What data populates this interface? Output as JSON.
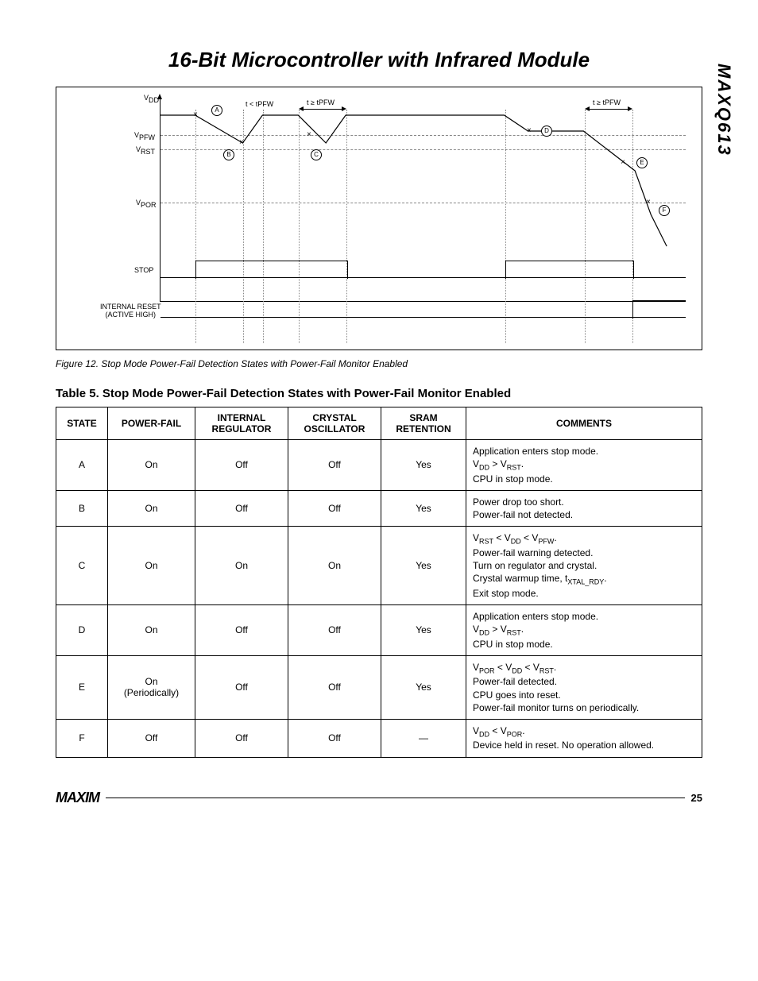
{
  "title": "16-Bit Microcontroller with Infrared Module",
  "part_number": "MAXQ613",
  "figure": {
    "caption": "Figure 12. Stop Mode Power-Fail Detection States with Power-Fail Monitor Enabled",
    "y_axis_label": "VDD",
    "levels": {
      "vpfw": "VPFW",
      "vrst": "VRST",
      "vpor": "VPOR"
    },
    "time_labels": {
      "t_lt": "t < tPFW",
      "t_ge1": "t ≥ tPFW",
      "t_ge2": "t ≥ tPFW"
    },
    "signals": {
      "stop": "STOP",
      "reset": "INTERNAL RESET\n(ACTIVE HIGH)"
    },
    "markers": [
      "A",
      "B",
      "C",
      "D",
      "E",
      "F"
    ]
  },
  "table": {
    "title": "Table 5. Stop Mode Power-Fail Detection States with Power-Fail Monitor Enabled",
    "headers": [
      "STATE",
      "POWER-FAIL",
      "INTERNAL REGULATOR",
      "CRYSTAL OSCILLATOR",
      "SRAM RETENTION",
      "COMMENTS"
    ],
    "rows": [
      {
        "state": "A",
        "pf": "On",
        "reg": "Off",
        "osc": "Off",
        "sram": "Yes",
        "comments": "Application enters stop mode.\nVDD > VRST.\nCPU in stop mode."
      },
      {
        "state": "B",
        "pf": "On",
        "reg": "Off",
        "osc": "Off",
        "sram": "Yes",
        "comments": "Power drop too short.\nPower-fail not detected."
      },
      {
        "state": "C",
        "pf": "On",
        "reg": "On",
        "osc": "On",
        "sram": "Yes",
        "comments": "VRST < VDD < VPFW.\nPower-fail warning detected.\nTurn on regulator and crystal.\nCrystal warmup time, tXTAL_RDY.\nExit stop mode."
      },
      {
        "state": "D",
        "pf": "On",
        "reg": "Off",
        "osc": "Off",
        "sram": "Yes",
        "comments": "Application enters stop mode.\nVDD > VRST.\nCPU in stop mode."
      },
      {
        "state": "E",
        "pf": "On\n(Periodically)",
        "reg": "Off",
        "osc": "Off",
        "sram": "Yes",
        "comments": "VPOR < VDD < VRST.\nPower-fail detected.\nCPU goes into reset.\nPower-fail monitor turns on periodically."
      },
      {
        "state": "F",
        "pf": "Off",
        "reg": "Off",
        "osc": "Off",
        "sram": "—",
        "comments": "VDD < VPOR.\nDevice held in reset. No operation allowed."
      }
    ]
  },
  "footer": {
    "logo": "MAXIM",
    "page": "25"
  },
  "chart_data": {
    "type": "timing-diagram",
    "y_levels": [
      "VDD_top",
      "VPFW",
      "VRST",
      "VPOR",
      "GND"
    ],
    "events": [
      {
        "id": "A",
        "desc": "enter stop, VDD high"
      },
      {
        "id": "B",
        "desc": "brief dip below VPFW, t<tPFW, not detected"
      },
      {
        "id": "C",
        "desc": "dip below VPFW, t>=tPFW, warning detected, exit stop"
      },
      {
        "id": "D",
        "desc": "re-enter stop, VDD recovered above VPFW"
      },
      {
        "id": "E",
        "desc": "VDD falls below VRST, t>=tPFW, reset asserted"
      },
      {
        "id": "F",
        "desc": "VDD falls below VPOR"
      }
    ],
    "signals": {
      "STOP": "high after A, low during C region, high after D, low after E",
      "INTERNAL_RESET": "low, goes high after E"
    }
  }
}
